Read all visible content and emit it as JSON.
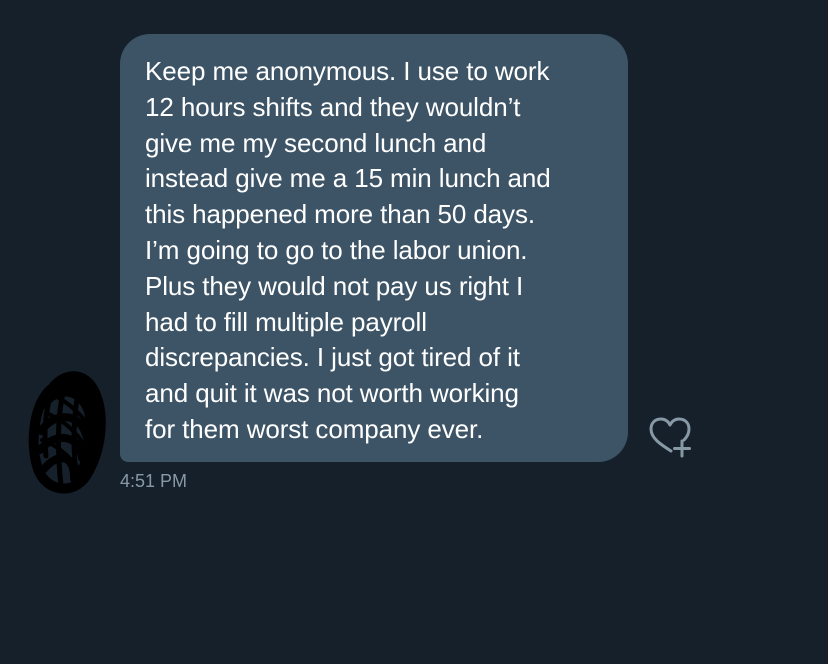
{
  "conversation": {
    "message": {
      "lines": [
        "Keep me anonymous. I use to work",
        "12 hours shifts and they wouldn’t",
        "give me my second lunch and",
        "instead give me a 15 min lunch and",
        "this happened more than 50 days.",
        "I’m going to go to the labor union.",
        "Plus they would not pay us right I",
        "had to fill multiple payroll",
        "discrepancies. I just got tired of it",
        "and quit it was not worth working",
        "for them worst company ever."
      ],
      "timestamp": "4:51 PM"
    },
    "actions": {
      "react_icon": "heart-plus-icon"
    },
    "colors": {
      "background": "#15202b",
      "bubble": "#3d5466",
      "text": "#ffffff",
      "secondary_text": "#8899a6",
      "icon": "#8899a6",
      "avatar_scribble": "#000000"
    }
  }
}
